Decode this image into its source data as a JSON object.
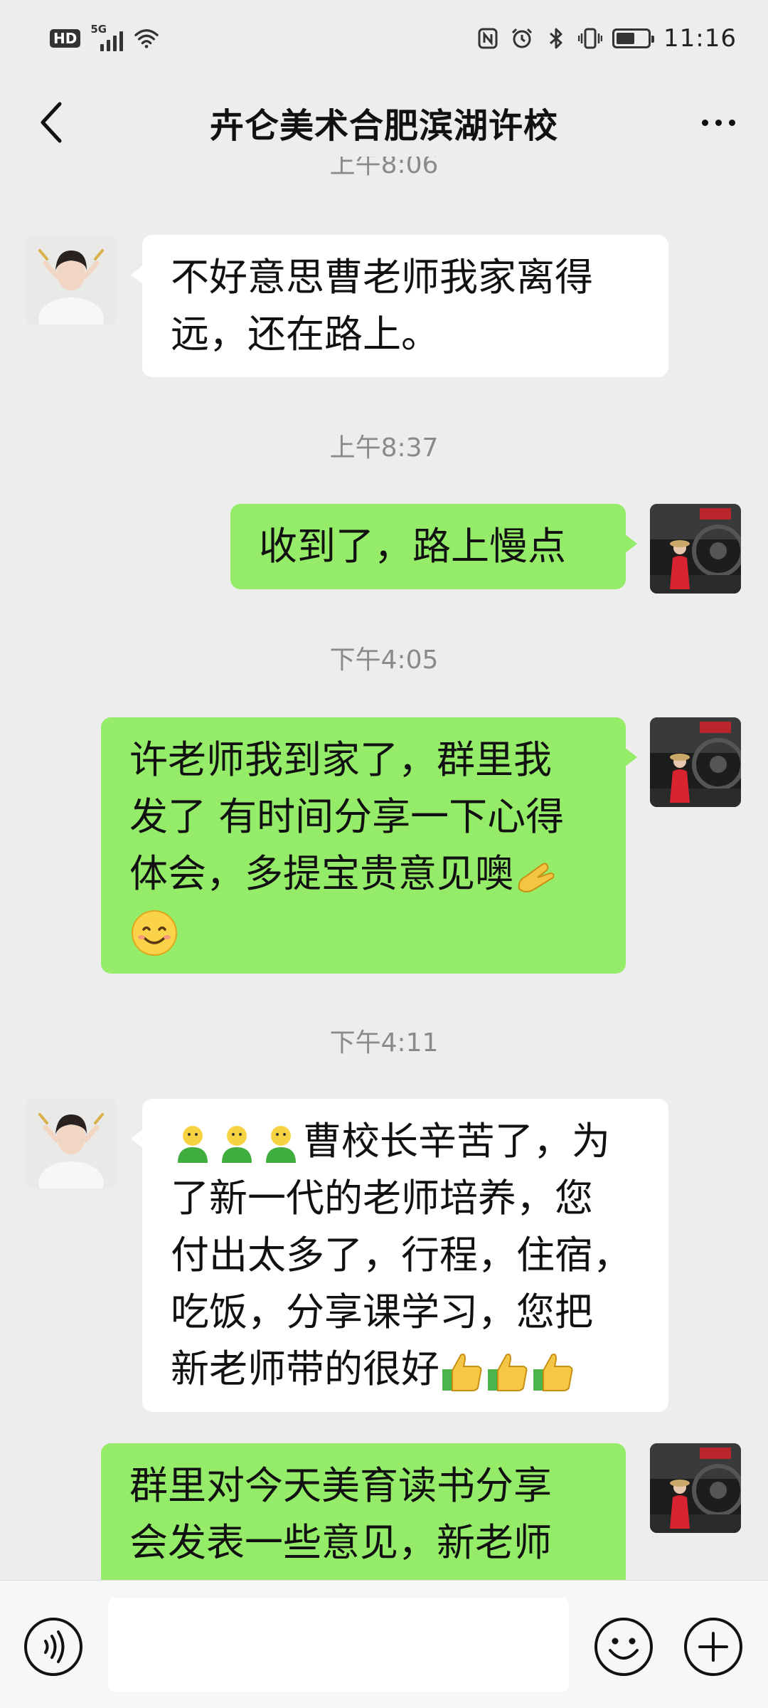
{
  "status_bar": {
    "hd": "HD",
    "network": "5G",
    "time": "11:16",
    "battery_level": 0.6,
    "icons": [
      "nfc-icon",
      "alarm-icon",
      "bluetooth-icon",
      "vibrate-icon",
      "battery-icon"
    ]
  },
  "header": {
    "title": "卉仑美术合肥滨湖许校",
    "back_icon": "chevron-left-icon",
    "more_icon": "more-dots-icon"
  },
  "messages": {
    "ts0": "上午8:06",
    "m1": {
      "sender": "other",
      "lines": [
        "不好意思曹老师我家离得",
        "远，还在路上。"
      ]
    },
    "ts1": "上午8:37",
    "m2": {
      "sender": "me",
      "lines": [
        "收到了，路上慢点"
      ]
    },
    "ts2": "下午4:05",
    "m3": {
      "sender": "me",
      "lines": [
        "许老师我到家了，群里我",
        "发了 有时间分享一下心得",
        "体会，多提宝贵意见噢"
      ]
    },
    "ts3": "下午4:11",
    "m4": {
      "sender": "other",
      "lines": [
        "曹校长辛苦了，为",
        "了新一代的老师培养，您",
        "付出太多了，行程，住宿，",
        "吃饭，分享课学习，您把",
        "新老师带的很好"
      ]
    },
    "m5": {
      "sender": "me",
      "lines": [
        "群里对今天美育读书分享",
        "会发表一些意见，新老师"
      ]
    }
  },
  "emoji": {
    "ok_hand": "ok-hand-emoji",
    "smile": "smiling-face-emoji",
    "person": "person-emoji",
    "thumbs_up": "thumbs-up-emoji"
  },
  "input_bar": {
    "voice_icon": "voice-input-icon",
    "emoji_icon": "emoji-icon",
    "plus_icon": "plus-icon",
    "placeholder": ""
  },
  "colors": {
    "background": "#EDEDED",
    "incoming_bubble": "#FFFFFF",
    "outgoing_bubble": "#95EC69",
    "timestamp": "#8A8A8A",
    "input_bar": "#F7F7F7"
  }
}
